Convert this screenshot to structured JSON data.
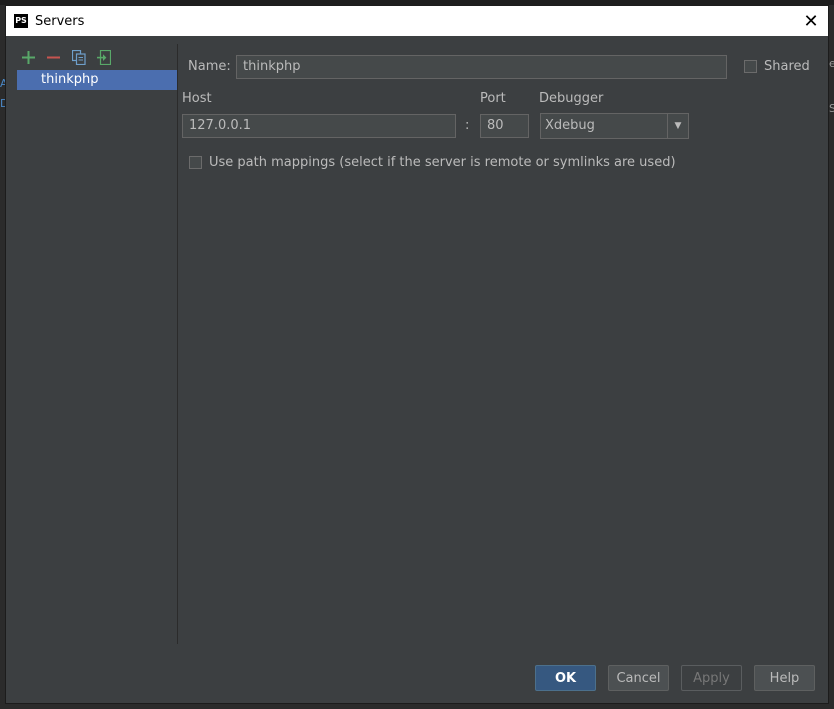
{
  "window": {
    "icon_text": "PS",
    "title": "Servers",
    "close_glyph": "✕"
  },
  "background_glyphs": {
    "left": [
      "A",
      "D"
    ],
    "right": [
      "e",
      "S"
    ]
  },
  "toolbar": {
    "icons": [
      "add-icon",
      "remove-icon",
      "copy-icon",
      "import-icon"
    ],
    "colors": {
      "add": "#59a869",
      "remove": "#c75450",
      "copy": "#6e9fca",
      "import": "#59a869"
    }
  },
  "servers": [
    {
      "label": "thinkphp",
      "selected": true
    }
  ],
  "form": {
    "name_label": "Name:",
    "name_value": "thinkphp",
    "shared_label": "Shared",
    "shared_checked": false,
    "host_label": "Host",
    "host_value": "127.0.0.1",
    "colon": ":",
    "port_label": "Port",
    "port_value": "80",
    "debugger_label": "Debugger",
    "debugger_value": "Xdebug",
    "debugger_arrow": "▼",
    "path_mappings_label": "Use path mappings (select if the server is remote or symlinks are used)",
    "path_mappings_checked": false
  },
  "buttons": {
    "ok": "OK",
    "cancel": "Cancel",
    "apply": "Apply",
    "help": "Help"
  },
  "colors": {
    "dialog_bg": "#3c3f41",
    "selection": "#4b6eaf",
    "ok_button": "#365880"
  }
}
